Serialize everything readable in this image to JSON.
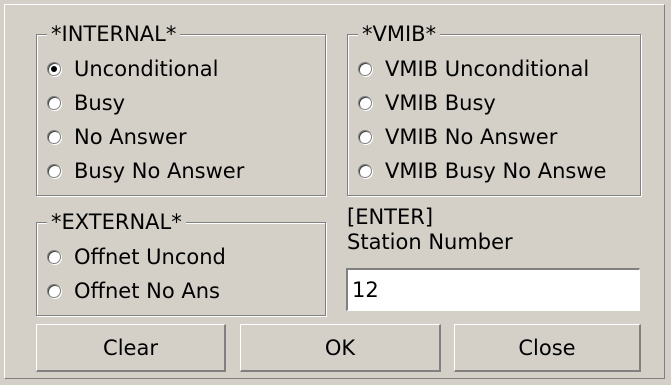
{
  "internal": {
    "legend": "*INTERNAL*",
    "options": [
      "Unconditional",
      "Busy",
      "No Answer",
      "Busy No Answer"
    ],
    "selected": "Unconditional"
  },
  "vmib": {
    "legend": "*VMIB*",
    "options": [
      "VMIB Unconditional",
      "VMIB Busy",
      "VMIB No Answer",
      "VMIB Busy No Answe"
    ]
  },
  "external": {
    "legend": "*EXTERNAL*",
    "options": [
      "Offnet Uncond",
      "Offnet No Ans"
    ]
  },
  "station": {
    "enter_label": "[ENTER]",
    "label": "Station Number",
    "value": "12"
  },
  "buttons": {
    "clear": "Clear",
    "ok": "OK",
    "close": "Close"
  }
}
